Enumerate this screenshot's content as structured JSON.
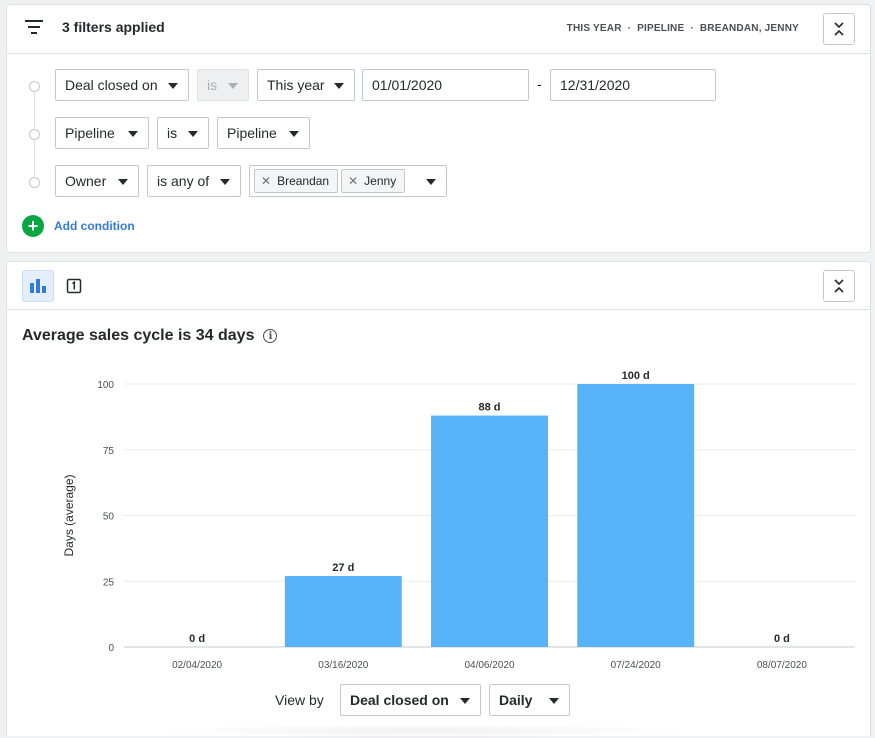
{
  "header": {
    "title": "3 filters applied",
    "summary": [
      "THIS YEAR",
      "PIPELINE",
      "BREANDAN, JENNY"
    ],
    "summary_sep": "·"
  },
  "filters": {
    "row1": {
      "field": "Deal closed on",
      "operator": "is",
      "value": "This year",
      "date_from": "01/01/2020",
      "date_sep": "-",
      "date_to": "12/31/2020"
    },
    "row2": {
      "field": "Pipeline",
      "operator": "is",
      "value": "Pipeline"
    },
    "row3": {
      "field": "Owner",
      "operator": "is any of",
      "chips": [
        "Breandan",
        "Jenny"
      ]
    },
    "add_condition": "Add condition"
  },
  "chart_header": {
    "title": "Average sales cycle is 34 days",
    "info_icon": "i"
  },
  "chart_data": {
    "type": "bar",
    "categories": [
      "02/04/2020",
      "03/16/2020",
      "04/06/2020",
      "07/24/2020",
      "08/07/2020"
    ],
    "values": [
      0,
      27,
      88,
      100,
      0
    ],
    "data_labels": [
      "0 d",
      "27 d",
      "88 d",
      "100 d",
      "0 d"
    ],
    "title": "",
    "xlabel": "",
    "ylabel": "Days (average)",
    "ylim": [
      0,
      100
    ],
    "yticks": [
      0,
      25,
      50,
      75,
      100
    ],
    "grid": true,
    "bar_color": "#56b3f7"
  },
  "view_by": {
    "label": "View by",
    "field": "Deal closed on",
    "interval": "Daily"
  },
  "colors": {
    "accent": "#317ae2",
    "add": "#08a742",
    "bar": "#56b3f7"
  }
}
